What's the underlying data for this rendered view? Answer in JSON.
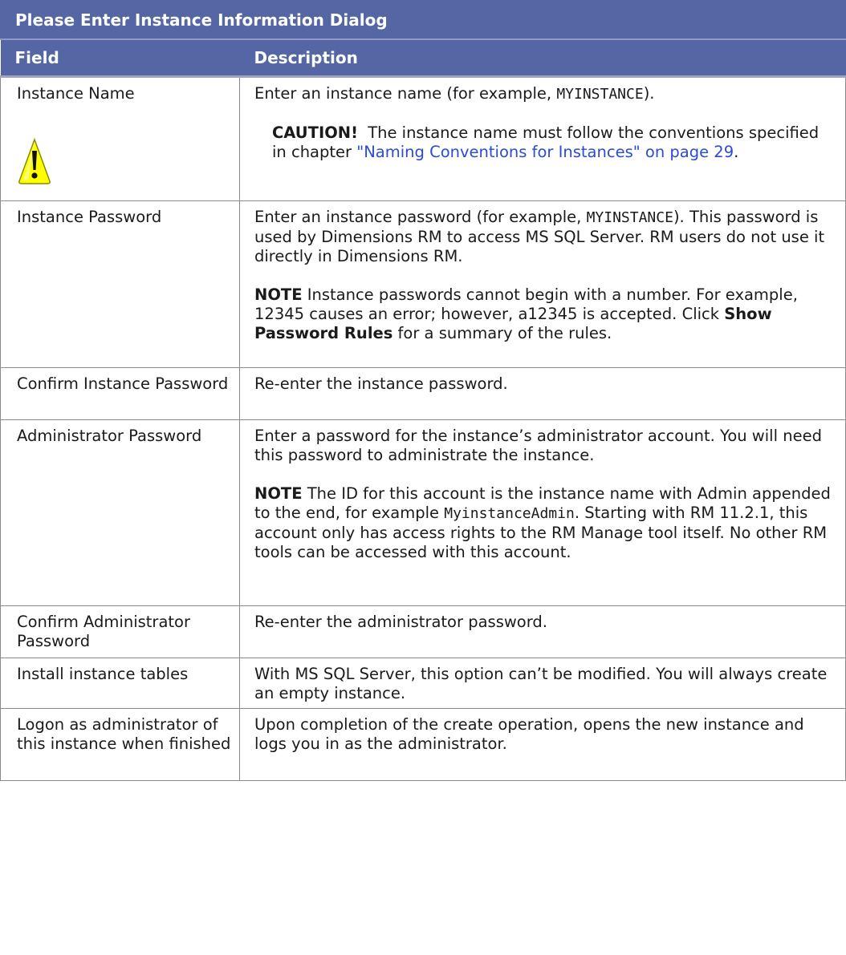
{
  "title": "Please Enter Instance Information Dialog",
  "headers": {
    "field": "Field",
    "description": "Description"
  },
  "colors": {
    "header_bg": "#5466a3",
    "header_text": "#ffffff",
    "link": "#2b4bd6",
    "warning_yellow": "#ffff00"
  },
  "rows": [
    {
      "field": "Instance Name",
      "icon": "caution-warning-icon",
      "desc_prefix": "Enter an instance name (for example, ",
      "desc_code": "MYINSTANCE",
      "desc_suffix": ").",
      "caution_label": "CAUTION!",
      "caution_text": "The instance name must follow the conventions specified in chapter ",
      "caution_link": "\"Naming Conventions for Instances\" on page 29",
      "caution_end": "."
    },
    {
      "field": "Instance Password",
      "desc_prefix": "Enter an instance password (for example, ",
      "desc_code": "MYINSTANCE",
      "desc_suffix": "). This password is used by Dimensions RM to access MS SQL Server. RM users do not use it directly in Dimensions RM.",
      "note_label": "NOTE",
      "note_text_1": " Instance passwords cannot begin with a number. For example, 12345 causes an error; however, a12345 is accepted. Click ",
      "note_bold": "Show Password Rules",
      "note_text_2": " for a summary of the rules."
    },
    {
      "field": "Confirm Instance Password",
      "desc": "Re-enter the instance password."
    },
    {
      "field": "Administrator Password",
      "desc": "Enter a password for the instance’s administrator account. You will need this password to administrate the instance.",
      "note_label": "NOTE",
      "note_text_1": " The ID for this account is the instance name with Admin appended to the end, for example ",
      "note_code": "MyinstanceAdmin",
      "note_text_2": ". Starting with RM 11.2.1, this account only has access rights to the RM Manage tool itself. No other RM tools can be accessed with this account."
    },
    {
      "field": "Confirm Administrator Password",
      "desc": "Re-enter the administrator password."
    },
    {
      "field": "Install instance tables",
      "desc": "With MS SQL Server, this option can’t be modified. You will always create an empty instance."
    },
    {
      "field": "Logon as administrator of this instance when finished",
      "desc": "Upon completion of the create operation, opens the new instance and logs you in as the administrator."
    }
  ]
}
